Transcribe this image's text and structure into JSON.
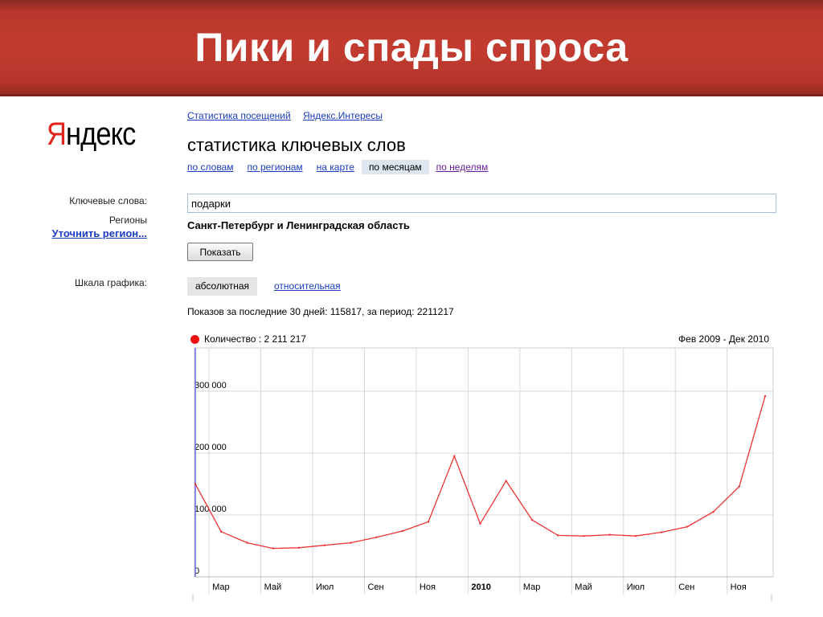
{
  "slide": {
    "title": "Пики и спады спроса"
  },
  "logo": {
    "part1": "Я",
    "part2": "ндекс"
  },
  "top_links": [
    "Статистика посещений",
    "Яндекс.Интересы"
  ],
  "service_title": "статистика ключевых слов",
  "tabs": [
    {
      "label": "по словам",
      "active": false
    },
    {
      "label": "по регионам",
      "active": false
    },
    {
      "label": "на карте",
      "active": false
    },
    {
      "label": "по месяцам",
      "active": true
    },
    {
      "label": "по неделям",
      "active": false
    }
  ],
  "form": {
    "keywords_label": "Ключевые слова:",
    "keywords_value": "подарки",
    "regions_label": "Регионы",
    "refine_region_link": "Уточнить регион...",
    "region_value": "Санкт-Петербург и Ленинградская область",
    "show_button": "Показать",
    "scale_label": "Шкала графика:",
    "scale_absolute": "абсолютная",
    "scale_relative": "относительная"
  },
  "summary": "Показов за последние 30 дней: 115817, за период: 2211217",
  "colors": {
    "series": "#ee3333",
    "link": "#1a3dc1",
    "banner": "#c33b30",
    "logo_accent": "#e2231a"
  },
  "chart_data": {
    "type": "line",
    "legend": "Количество : 2 211 217",
    "period": "Фев 2009 - Дек 2010",
    "y_ticks": [
      0,
      100000,
      200000,
      300000
    ],
    "y_tick_labels": [
      "0",
      "100 000",
      "200 000",
      "300 000"
    ],
    "ylim": [
      0,
      370000
    ],
    "x": [
      "Фев 2009",
      "Мар 2009",
      "Апр 2009",
      "Май 2009",
      "Июн 2009",
      "Июл 2009",
      "Авг 2009",
      "Сен 2009",
      "Окт 2009",
      "Ноя 2009",
      "Дек 2009",
      "Янв 2010",
      "Фев 2010",
      "Мар 2010",
      "Апр 2010",
      "Май 2010",
      "Июн 2010",
      "Июл 2010",
      "Авг 2010",
      "Сен 2010",
      "Окт 2010",
      "Ноя 2010",
      "Дек 2010"
    ],
    "x_tick_labels": [
      {
        "index": 1,
        "label": "Мар",
        "bold": false
      },
      {
        "index": 3,
        "label": "Май",
        "bold": false
      },
      {
        "index": 5,
        "label": "Июл",
        "bold": false
      },
      {
        "index": 7,
        "label": "Сен",
        "bold": false
      },
      {
        "index": 9,
        "label": "Ноя",
        "bold": false
      },
      {
        "index": 11,
        "label": "2010",
        "bold": true
      },
      {
        "index": 13,
        "label": "Мар",
        "bold": false
      },
      {
        "index": 15,
        "label": "Май",
        "bold": false
      },
      {
        "index": 17,
        "label": "Июл",
        "bold": false
      },
      {
        "index": 19,
        "label": "Сен",
        "bold": false
      },
      {
        "index": 21,
        "label": "Ноя",
        "bold": false
      }
    ],
    "series": [
      {
        "name": "Количество",
        "values": [
          150000,
          73000,
          55000,
          46000,
          47000,
          51000,
          55000,
          64000,
          74000,
          89000,
          195000,
          86000,
          155000,
          92000,
          67000,
          66000,
          68000,
          66000,
          72000,
          81000,
          105000,
          146000,
          292000
        ]
      }
    ]
  }
}
